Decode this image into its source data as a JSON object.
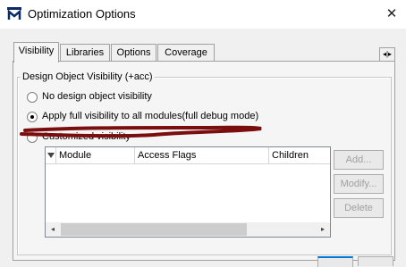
{
  "window": {
    "title": "Optimization Options"
  },
  "tabs": [
    {
      "label": "Visibility",
      "active": true
    },
    {
      "label": "Libraries",
      "active": false
    },
    {
      "label": "Options",
      "active": false
    },
    {
      "label": "Coverage",
      "active": false
    }
  ],
  "tab_scroll": {
    "glyph": "◂|▸"
  },
  "visibility": {
    "group_title": "Design Object Visibility (+acc)",
    "options": [
      {
        "label": "No design object visibility",
        "selected": false
      },
      {
        "label": "Apply full visibility to all modules(full debug mode)",
        "selected": true
      },
      {
        "label": "Customized visibility",
        "selected": false
      }
    ],
    "columns": [
      "Module",
      "Access Flags",
      "Children"
    ],
    "buttons": {
      "add": "Add...",
      "modify": "Modify...",
      "delete": "Delete"
    }
  },
  "colors": {
    "annotation": "#7a0e0e",
    "accent": "#0078d7"
  }
}
